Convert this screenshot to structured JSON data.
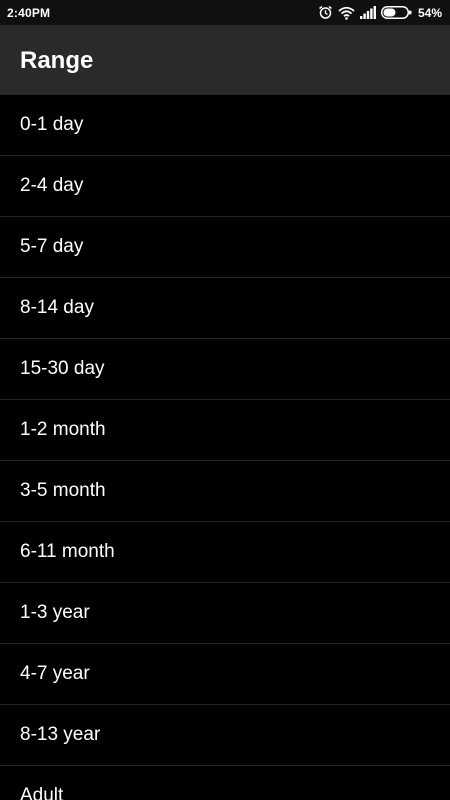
{
  "status_bar": {
    "time": "2:40PM",
    "battery_percent": "54%",
    "icons": [
      "alarm-icon",
      "wifi-icon",
      "signal-icon",
      "battery-icon"
    ],
    "battery_level": 0.54
  },
  "toolbar": {
    "title": "Range"
  },
  "range_list": {
    "items": [
      {
        "label": "0-1 day"
      },
      {
        "label": "2-4 day"
      },
      {
        "label": "5-7 day"
      },
      {
        "label": "8-14 day"
      },
      {
        "label": "15-30 day"
      },
      {
        "label": "1-2 month"
      },
      {
        "label": "3-5 month"
      },
      {
        "label": "6-11 month"
      },
      {
        "label": "1-3 year"
      },
      {
        "label": "4-7 year"
      },
      {
        "label": "8-13 year"
      },
      {
        "label": "Adult"
      }
    ]
  },
  "colors": {
    "background": "#000000",
    "toolbar": "#2a2a2a",
    "text": "#ffffff",
    "divider": "#262626"
  }
}
